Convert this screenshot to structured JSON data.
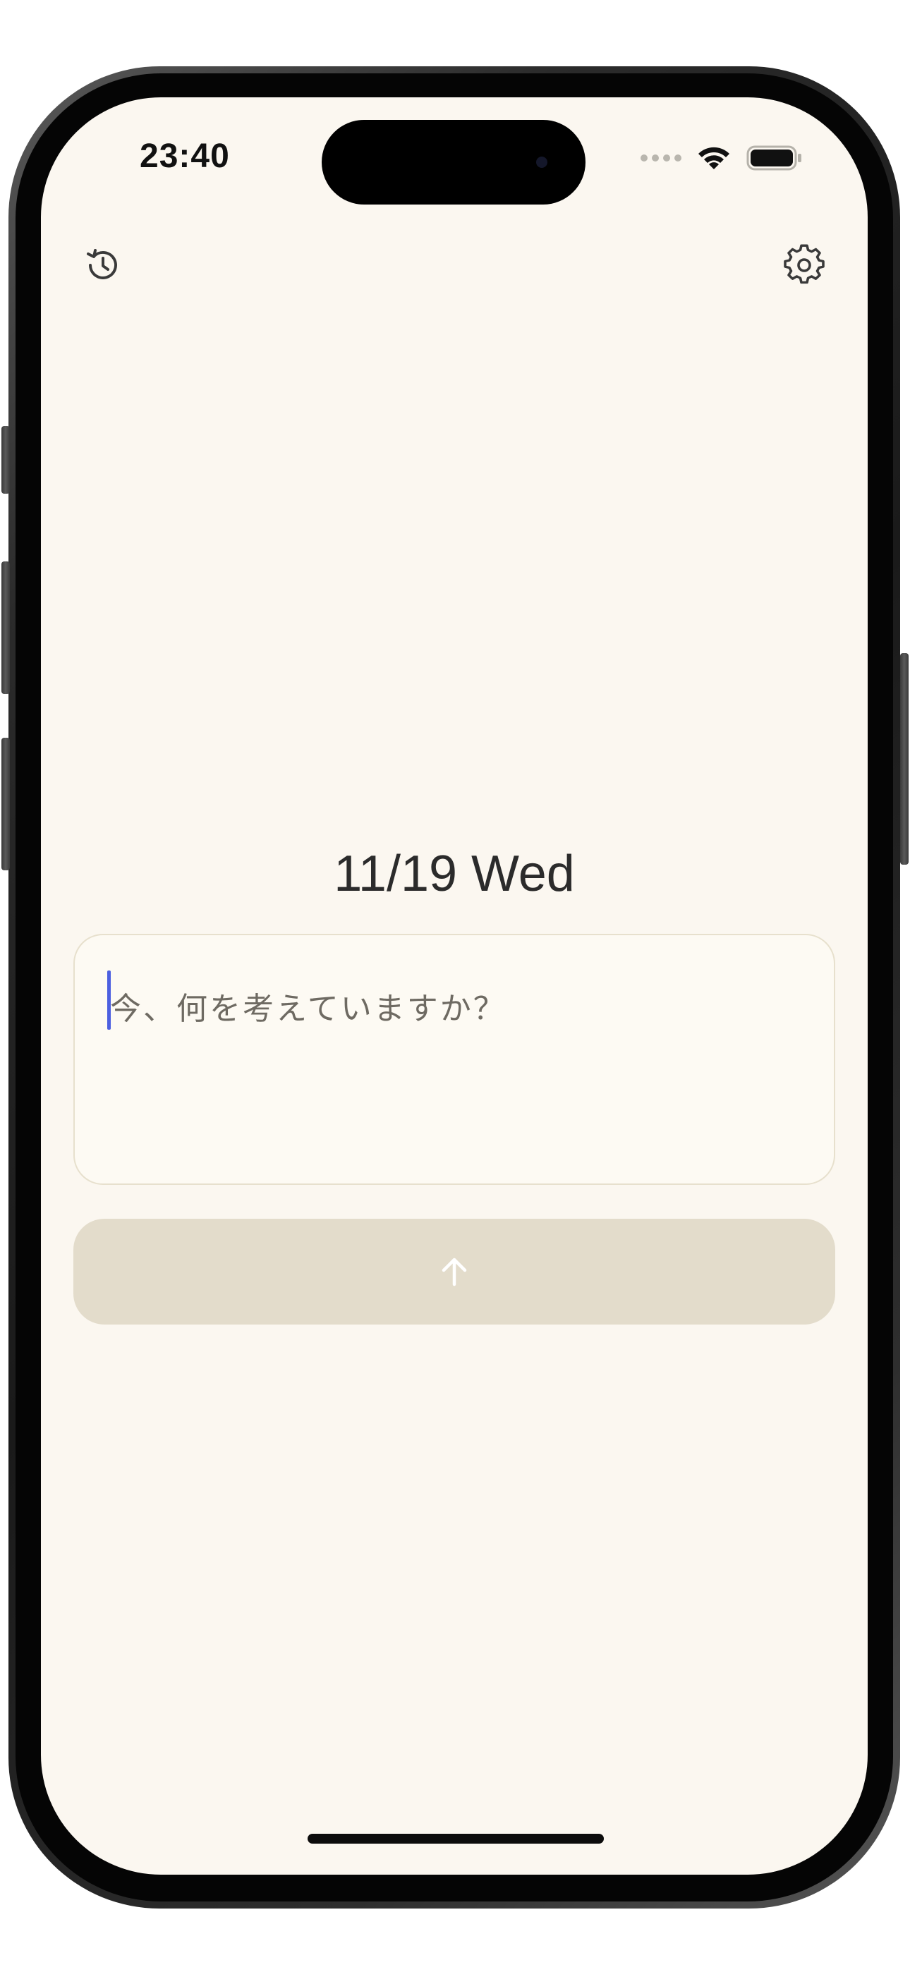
{
  "status_bar": {
    "time": "23:40"
  },
  "toolbar": {
    "history_icon": "history-icon",
    "settings_icon": "gear-icon"
  },
  "main": {
    "date": "11/19 Wed",
    "input_placeholder": "今、何を考えていますか？",
    "input_value": "",
    "send_icon": "arrow-up-icon"
  },
  "colors": {
    "background": "#fbf7f0",
    "input_border": "#e7e0cd",
    "send_button": "#e3dccb",
    "caret": "#4c5fe0"
  }
}
